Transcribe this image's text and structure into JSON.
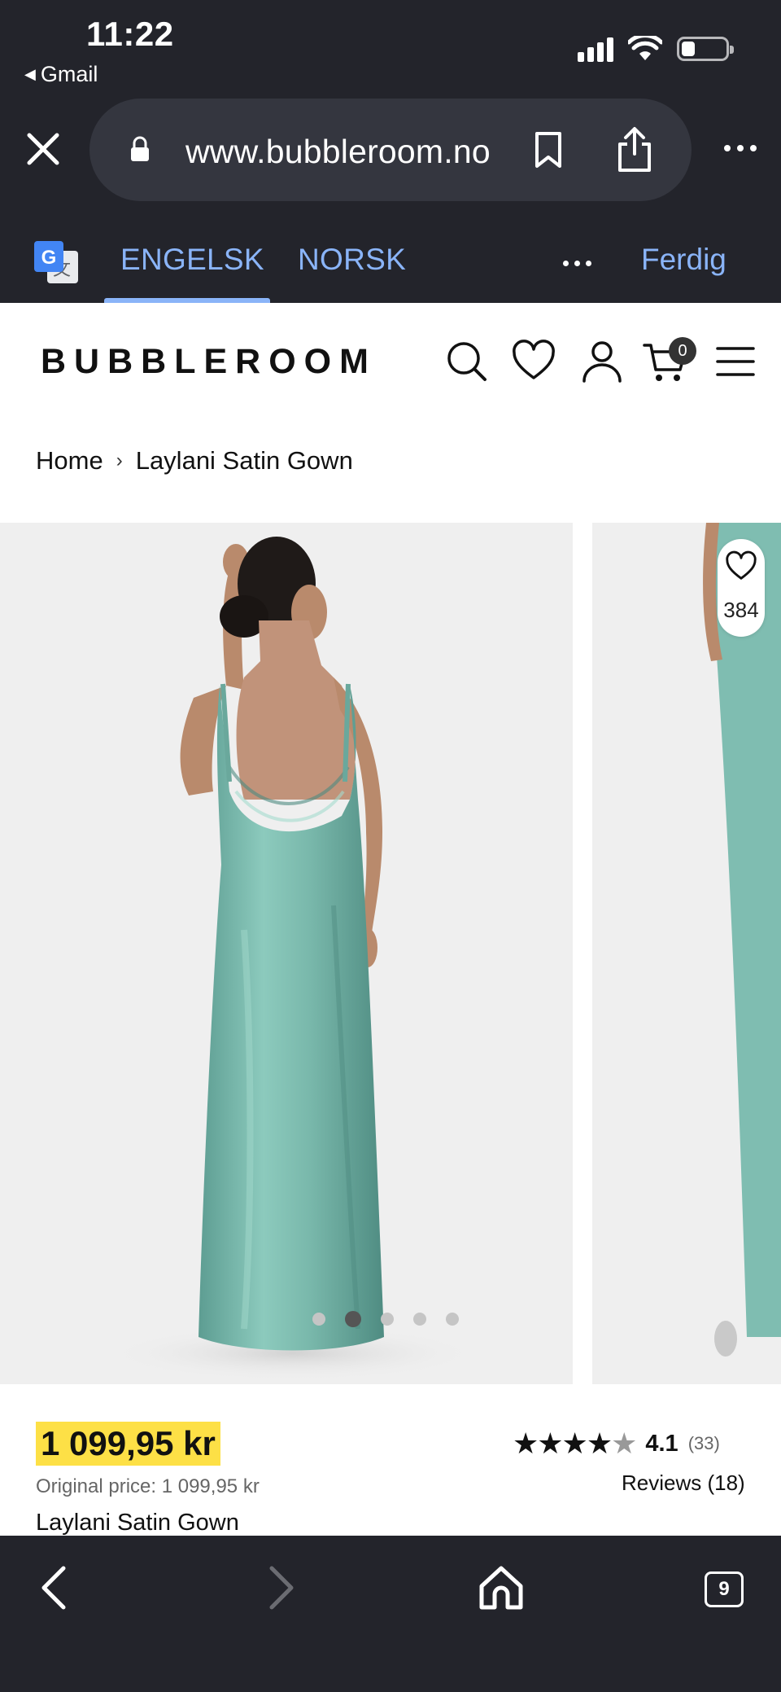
{
  "status_bar": {
    "time": "11:22",
    "back_app": "Gmail"
  },
  "browser": {
    "url": "www.bubbleroom.no",
    "icons": [
      "close-icon",
      "lock-icon",
      "bookmark-icon",
      "share-icon",
      "more-icon"
    ]
  },
  "translate": {
    "source_tab": "ENGELSK",
    "target_tab": "NORSK",
    "done_label": "Ferdig",
    "accent": "#8ab4f8"
  },
  "site": {
    "logo": "BUBBLEROOM",
    "cart_count": "0",
    "icons": [
      "search-icon",
      "heart-icon",
      "account-icon",
      "cart-icon",
      "menu-icon"
    ]
  },
  "breadcrumb": {
    "home": "Home",
    "separator": "›",
    "current": "Laylani Satin Gown"
  },
  "gallery": {
    "wishlist_count": "384",
    "image_count": 5,
    "active_index": 1,
    "dress_color": "#7fbfb3"
  },
  "product": {
    "price": "1 099,95 kr",
    "original_price": "Original price: 1 099,95 kr",
    "name": "Laylani Satin Gown",
    "rating_value": "4.1",
    "rating_count": "(33)",
    "reviews_link": "Reviews (18)",
    "price_highlight": "#fde046"
  },
  "toolbar": {
    "tabs_count": "9",
    "icons": [
      "back-icon",
      "forward-icon",
      "home-icon",
      "tabs-icon"
    ]
  }
}
